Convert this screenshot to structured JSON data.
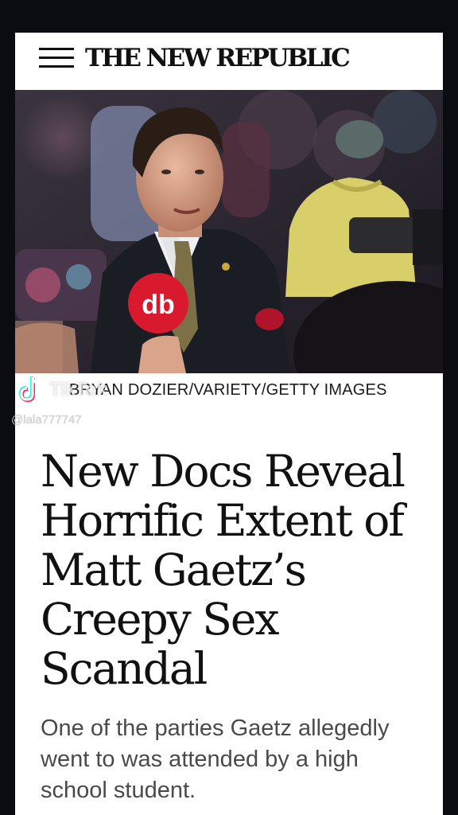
{
  "header": {
    "brand": "THE NEW REPUBLIC",
    "menu_icon": "hamburger-menu-icon"
  },
  "hero": {
    "photo_description_icon": "news-photo",
    "mic_logo": "db"
  },
  "article": {
    "photo_credit": "BRYAN DOZIER/VARIETY/GETTY IMAGES",
    "headline": "New Docs Reveal Horrific Extent of Matt Gaetz’s Creepy Sex Scandal",
    "dek": "One of the parties Gaetz allegedly went to was attended by a high school student."
  },
  "watermark": {
    "app": "TikTok",
    "username": "@lala777747",
    "icon": "tiktok-logo-icon"
  },
  "colors": {
    "background": "#0b0b12",
    "page": "#ffffff",
    "headline": "#111111",
    "dek": "#4a4a4a",
    "mic_red": "#d8192e"
  }
}
